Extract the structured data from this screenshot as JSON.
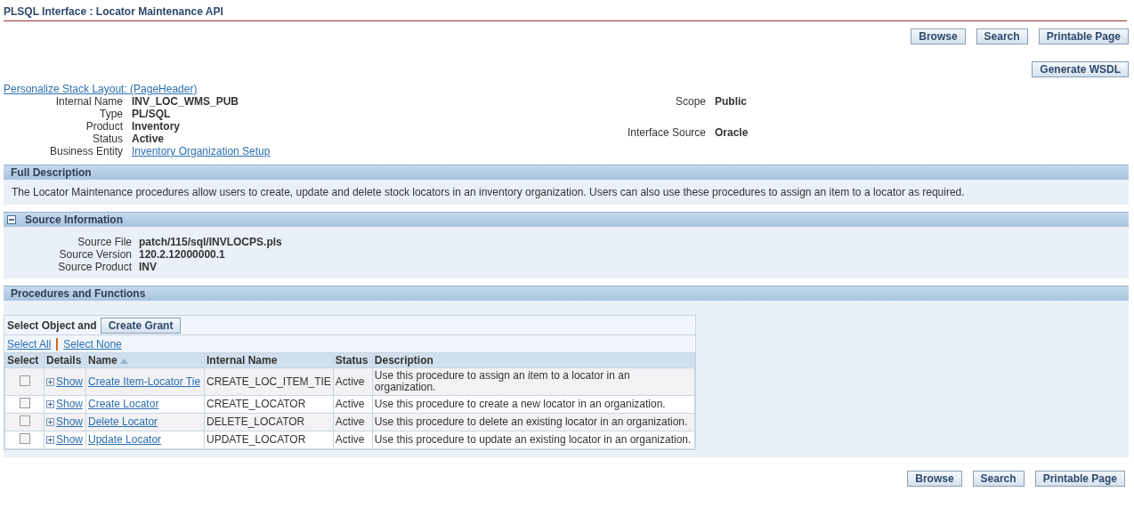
{
  "page_title": "PLSQL Interface : Locator Maintenance API",
  "top_buttons": [
    "Browse",
    "Search",
    "Printable Page"
  ],
  "generate_button": "Generate WSDL",
  "personalize_link": "Personalize Stack Layout: (PageHeader)",
  "header_fields_left": [
    {
      "label": "Internal Name",
      "value": "INV_LOC_WMS_PUB",
      "kind": "text"
    },
    {
      "label": "Type",
      "value": "PL/SQL",
      "kind": "text"
    },
    {
      "label": "Product",
      "value": "Inventory",
      "kind": "text"
    },
    {
      "label": "Status",
      "value": "Active",
      "kind": "text"
    },
    {
      "label": "Business Entity",
      "value": "Inventory Organization Setup",
      "kind": "link"
    }
  ],
  "header_fields_right": [
    {
      "label": "Scope",
      "value": "Public",
      "kind": "text"
    },
    {
      "label": "Interface Source",
      "value": "Oracle",
      "kind": "text"
    }
  ],
  "full_description": {
    "title": "Full Description",
    "text": "The Locator Maintenance procedures allow users to create, update and delete stock locators in an inventory organization. Users can also use these procedures to assign an item to a locator as required."
  },
  "source_information": {
    "title": "Source Information",
    "expanded": true,
    "fields": [
      {
        "label": "Source File",
        "value": "patch/115/sql/INVLOCPS.pls"
      },
      {
        "label": "Source Version",
        "value": "120.2.12000000.1"
      },
      {
        "label": "Source Product",
        "value": "INV"
      }
    ]
  },
  "procedures": {
    "title": "Procedures and Functions",
    "action_label": "Select Object and",
    "action_button": "Create Grant",
    "select_all": "Select All",
    "select_none": "Select None",
    "columns": [
      {
        "label": "Select",
        "sorted": false
      },
      {
        "label": "Details",
        "sorted": false
      },
      {
        "label": "Name",
        "sorted": true
      },
      {
        "label": "Internal Name",
        "sorted": false
      },
      {
        "label": "Status",
        "sorted": false
      },
      {
        "label": "Description",
        "sorted": false
      }
    ],
    "rows": [
      {
        "selected": false,
        "details": "Show",
        "name": "Create Item-Locator Tie",
        "internal_name": "CREATE_LOC_ITEM_TIE",
        "status": "Active",
        "description": "Use this procedure to assign an item to a locator in an organization."
      },
      {
        "selected": false,
        "details": "Show",
        "name": "Create Locator",
        "internal_name": "CREATE_LOCATOR",
        "status": "Active",
        "description": "Use this procedure to create a new locator in an organization."
      },
      {
        "selected": false,
        "details": "Show",
        "name": "Delete Locator",
        "internal_name": "DELETE_LOCATOR",
        "status": "Active",
        "description": "Use this procedure to delete an existing locator in an organization."
      },
      {
        "selected": false,
        "details": "Show",
        "name": "Update Locator",
        "internal_name": "UPDATE_LOCATOR",
        "status": "Active",
        "description": "Use this procedure to update an existing locator in an organization."
      }
    ]
  },
  "bottom_buttons": [
    "Browse",
    "Search",
    "Printable Page"
  ]
}
